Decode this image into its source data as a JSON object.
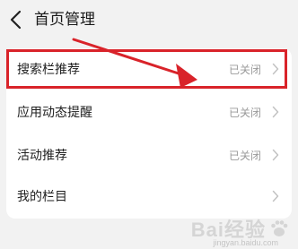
{
  "header": {
    "title": "首页管理"
  },
  "settings": {
    "rows": [
      {
        "label": "搜索栏推荐",
        "status": "已关闭"
      },
      {
        "label": "应用动态提醒",
        "status": "已关闭"
      },
      {
        "label": "活动推荐",
        "status": "已关闭"
      },
      {
        "label": "我的栏目",
        "status": ""
      }
    ]
  },
  "annotation": {
    "color": "#d9232a"
  },
  "watermark": {
    "brand": "Bai经验",
    "url": "jingyan.baidu.com"
  },
  "icons": {
    "back": "back-arrow-icon",
    "chevron": "chevron-right-icon",
    "paw": "baidu-paw-icon"
  }
}
